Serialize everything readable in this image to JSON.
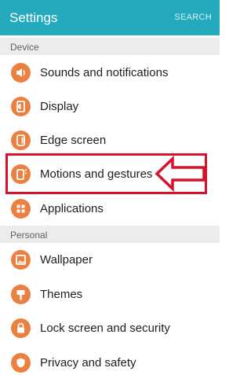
{
  "app_bar": {
    "title": "Settings",
    "search_label": "SEARCH"
  },
  "sections": {
    "device": {
      "header": "Device"
    },
    "personal": {
      "header": "Personal"
    }
  },
  "items": {
    "sounds": {
      "label": "Sounds and notifications",
      "icon": "volume-icon"
    },
    "display": {
      "label": "Display",
      "icon": "display-icon"
    },
    "edge": {
      "label": "Edge screen",
      "icon": "edge-screen-icon"
    },
    "motions": {
      "label": "Motions and gestures",
      "icon": "motions-icon",
      "highlighted": true
    },
    "applications": {
      "label": "Applications",
      "icon": "apps-grid-icon"
    },
    "wallpaper": {
      "label": "Wallpaper",
      "icon": "image-icon"
    },
    "themes": {
      "label": "Themes",
      "icon": "brush-icon"
    },
    "lock": {
      "label": "Lock screen and security",
      "icon": "lock-icon"
    },
    "privacy": {
      "label": "Privacy and safety",
      "icon": "shield-icon"
    }
  },
  "colors": {
    "app_bar": "#25a9bd",
    "icon_orange": "#ec8040",
    "highlight_red": "#d9112b",
    "section_bg": "#ececec"
  }
}
